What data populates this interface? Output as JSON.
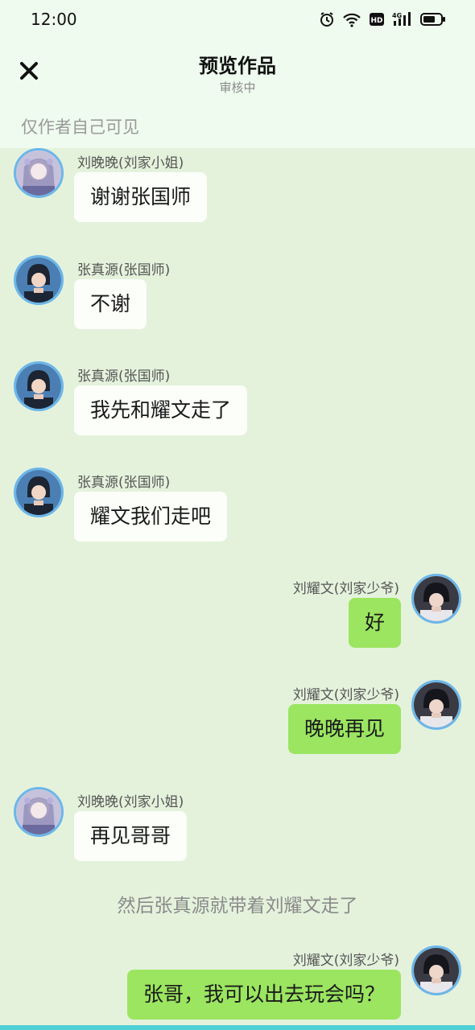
{
  "status_bar": {
    "time": "12:00",
    "icons": [
      "alarm-icon",
      "wifi-icon",
      "hd-icon",
      "signal-4g-icon",
      "battery-icon"
    ],
    "network_label": "4G",
    "hd_label": "HD"
  },
  "header": {
    "title": "预览作品",
    "subtitle": "审核中",
    "close_icon": "close-icon",
    "visibility_note": "仅作者自己可见"
  },
  "messages": [
    {
      "side": "left",
      "sender": "刘晚晚(刘家小姐)",
      "text": "谢谢张国师",
      "avatar": "avatar-liu-wanwan"
    },
    {
      "side": "left",
      "sender": "张真源(张国师)",
      "text": "不谢",
      "avatar": "avatar-zhang-zhenyuan"
    },
    {
      "side": "left",
      "sender": "张真源(张国师)",
      "text": "我先和耀文走了",
      "avatar": "avatar-zhang-zhenyuan"
    },
    {
      "side": "left",
      "sender": "张真源(张国师)",
      "text": "耀文我们走吧",
      "avatar": "avatar-zhang-zhenyuan"
    },
    {
      "side": "right",
      "sender": "刘耀文(刘家少爷)",
      "text": "好",
      "avatar": "avatar-liu-yaowen"
    },
    {
      "side": "right",
      "sender": "刘耀文(刘家少爷)",
      "text": "晚晚再见",
      "avatar": "avatar-liu-yaowen"
    },
    {
      "side": "left",
      "sender": "刘晚晚(刘家小姐)",
      "text": "再见哥哥",
      "avatar": "avatar-liu-wanwan"
    },
    {
      "side": "right",
      "sender": "刘耀文(刘家少爷)",
      "text": "张哥，我可以出去玩会吗？",
      "avatar": "avatar-liu-yaowen"
    }
  ],
  "narration": "然后张真源就带着刘耀文走了",
  "colors": {
    "background": "#e4f2dc",
    "header_background": "#effbef",
    "left_bubble": "#fbfef9",
    "right_bubble": "#9be560",
    "avatar_ring": "#6bb6ea"
  }
}
